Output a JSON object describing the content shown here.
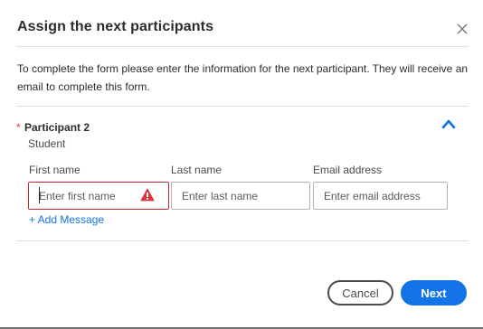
{
  "dialog": {
    "title": "Assign the next participants",
    "intro": "To complete the form please enter the information for the next participant. They will receive an email to complete this form.",
    "close_icon": "close-icon"
  },
  "participant": {
    "required_marker": "*",
    "name": "Participant 2",
    "role": "Student",
    "collapse_icon": "chevron-up-icon",
    "fields": {
      "first_name": {
        "label": "First name",
        "placeholder": "Enter first name",
        "value": "",
        "state": "error"
      },
      "last_name": {
        "label": "Last name",
        "placeholder": "Enter last name",
        "value": ""
      },
      "email": {
        "label": "Email address",
        "placeholder": "Enter email address",
        "value": ""
      }
    },
    "warning_icon": "alert-triangle-icon",
    "add_message": "+ Add Message"
  },
  "footer": {
    "cancel_label": "Cancel",
    "next_label": "Next"
  },
  "colors": {
    "accent": "#1473e6",
    "error": "#c9252d",
    "warning": "#d7373f",
    "text": "#2c2c2c"
  }
}
